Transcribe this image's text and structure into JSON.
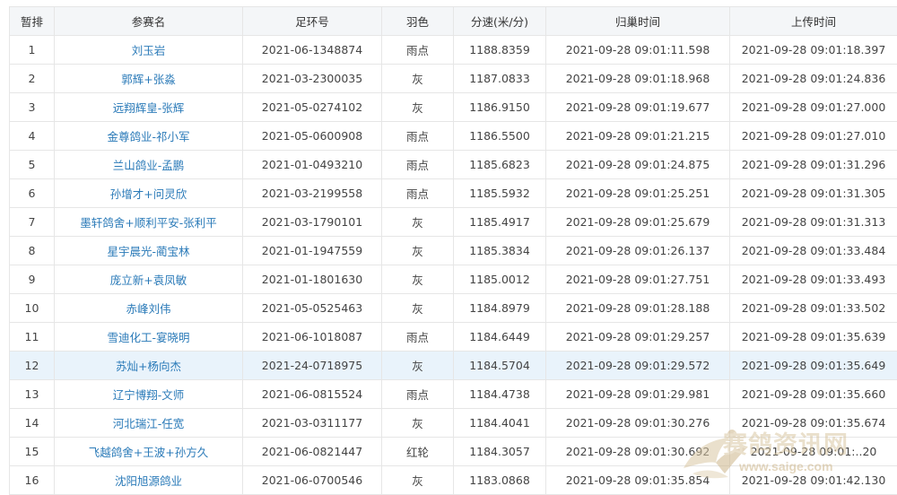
{
  "headers": [
    "暂排",
    "参赛名",
    "足环号",
    "羽色",
    "分速(米/分)",
    "归巢时间",
    "上传时间"
  ],
  "rows": [
    {
      "rank": "1",
      "name": "刘玉岩",
      "ring": "2021-06-1348874",
      "color": "雨点",
      "speed": "1188.8359",
      "arrival": "2021-09-28 09:01:11.598",
      "upload": "2021-09-28 09:01:18.397"
    },
    {
      "rank": "2",
      "name": "郭辉+张淼",
      "ring": "2021-03-2300035",
      "color": "灰",
      "speed": "1187.0833",
      "arrival": "2021-09-28 09:01:18.968",
      "upload": "2021-09-28 09:01:24.836"
    },
    {
      "rank": "3",
      "name": "远翔辉皇-张辉",
      "ring": "2021-05-0274102",
      "color": "灰",
      "speed": "1186.9150",
      "arrival": "2021-09-28 09:01:19.677",
      "upload": "2021-09-28 09:01:27.000"
    },
    {
      "rank": "4",
      "name": "金尊鸽业-祁小军",
      "ring": "2021-05-0600908",
      "color": "雨点",
      "speed": "1186.5500",
      "arrival": "2021-09-28 09:01:21.215",
      "upload": "2021-09-28 09:01:27.010"
    },
    {
      "rank": "5",
      "name": "兰山鸽业-孟鹏",
      "ring": "2021-01-0493210",
      "color": "雨点",
      "speed": "1185.6823",
      "arrival": "2021-09-28 09:01:24.875",
      "upload": "2021-09-28 09:01:31.296"
    },
    {
      "rank": "6",
      "name": "孙增才+问灵欣",
      "ring": "2021-03-2199558",
      "color": "雨点",
      "speed": "1185.5932",
      "arrival": "2021-09-28 09:01:25.251",
      "upload": "2021-09-28 09:01:31.305"
    },
    {
      "rank": "7",
      "name": "墨轩鸽舍+顺利平安-张利平",
      "ring": "2021-03-1790101",
      "color": "灰",
      "speed": "1185.4917",
      "arrival": "2021-09-28 09:01:25.679",
      "upload": "2021-09-28 09:01:31.313"
    },
    {
      "rank": "8",
      "name": "星宇晨光-蔺宝林",
      "ring": "2021-01-1947559",
      "color": "灰",
      "speed": "1185.3834",
      "arrival": "2021-09-28 09:01:26.137",
      "upload": "2021-09-28 09:01:33.484"
    },
    {
      "rank": "9",
      "name": "庞立新+袁凤敏",
      "ring": "2021-01-1801630",
      "color": "灰",
      "speed": "1185.0012",
      "arrival": "2021-09-28 09:01:27.751",
      "upload": "2021-09-28 09:01:33.493"
    },
    {
      "rank": "10",
      "name": "赤峰刘伟",
      "ring": "2021-05-0525463",
      "color": "灰",
      "speed": "1184.8979",
      "arrival": "2021-09-28 09:01:28.188",
      "upload": "2021-09-28 09:01:33.502"
    },
    {
      "rank": "11",
      "name": "雪迪化工-宴晓明",
      "ring": "2021-06-1018087",
      "color": "雨点",
      "speed": "1184.6449",
      "arrival": "2021-09-28 09:01:29.257",
      "upload": "2021-09-28 09:01:35.639"
    },
    {
      "rank": "12",
      "name": "苏灿+杨向杰",
      "ring": "2021-24-0718975",
      "color": "灰",
      "speed": "1184.5704",
      "arrival": "2021-09-28 09:01:29.572",
      "upload": "2021-09-28 09:01:35.649"
    },
    {
      "rank": "13",
      "name": "辽宁博翔-文师",
      "ring": "2021-06-0815524",
      "color": "雨点",
      "speed": "1184.4738",
      "arrival": "2021-09-28 09:01:29.981",
      "upload": "2021-09-28 09:01:35.660"
    },
    {
      "rank": "14",
      "name": "河北瑞江-任宽",
      "ring": "2021-03-0311177",
      "color": "灰",
      "speed": "1184.4041",
      "arrival": "2021-09-28 09:01:30.276",
      "upload": "2021-09-28 09:01:35.674"
    },
    {
      "rank": "15",
      "name": "飞越鸽舍+王波+孙方久",
      "ring": "2021-06-0821447",
      "color": "红轮",
      "speed": "1184.3057",
      "arrival": "2021-09-28 09:01:30.692",
      "upload": "2021-09-28 09:01:..20"
    },
    {
      "rank": "16",
      "name": "沈阳旭源鸽业",
      "ring": "2021-06-0700546",
      "color": "灰",
      "speed": "1183.0868",
      "arrival": "2021-09-28 09:01:35.854",
      "upload": "2021-09-28 09:01:42.130"
    }
  ],
  "highlighted_row": 12,
  "watermark": {
    "title": "赛鸽资讯网",
    "url": "www.saige.com"
  },
  "colors": {
    "name_link": "#2a7ab8",
    "highlight": "#e9f3fb",
    "header_bg": "#f4f6f8",
    "border": "#e6e6e6"
  }
}
